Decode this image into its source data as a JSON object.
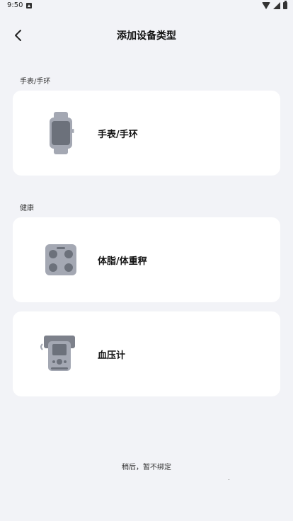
{
  "status_bar": {
    "time": "9:50"
  },
  "header": {
    "title": "添加设备类型"
  },
  "sections": [
    {
      "label": "手表/手环",
      "items": [
        {
          "label": "手表/手环",
          "icon": "smartwatch-icon"
        }
      ]
    },
    {
      "label": "健康",
      "items": [
        {
          "label": "体脂/体重秤",
          "icon": "body-fat-scale-icon"
        },
        {
          "label": "血压计",
          "icon": "blood-pressure-monitor-icon"
        }
      ]
    }
  ],
  "footer": {
    "skip_label": "稍后，暂不绑定"
  },
  "colors": {
    "background": "#f2f3f7",
    "card": "#ffffff",
    "icon_gray": "#a4a8b3",
    "icon_dark": "#6c717b"
  }
}
